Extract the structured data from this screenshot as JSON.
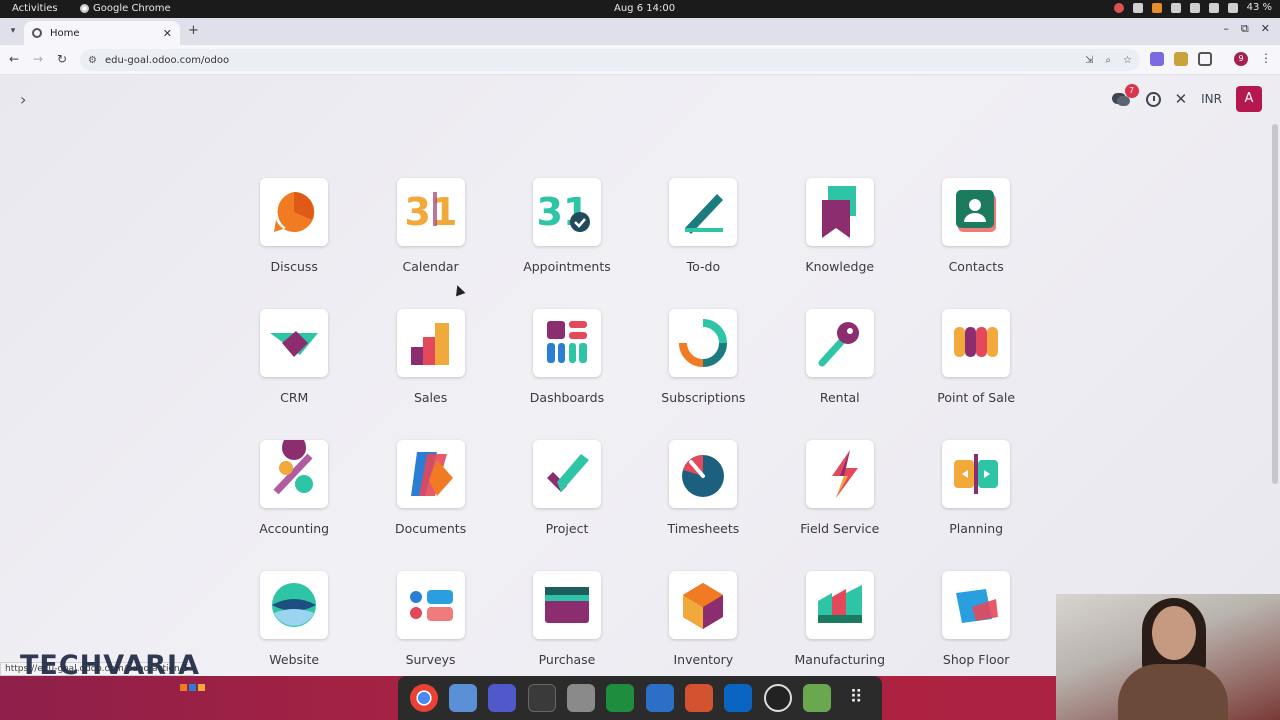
{
  "system_bar": {
    "activities": "Activities",
    "app_name": "Google Chrome",
    "clock": "Aug 6  14:00",
    "battery": "43 %"
  },
  "browser": {
    "tab_title": "Home",
    "url": "edu-goal.odoo.com/odoo",
    "status_url": "https://edu-goal.odoo.com/odoo/action-5"
  },
  "header": {
    "messages_badge": "7",
    "currency": "INR",
    "avatar_letter": "A"
  },
  "apps": [
    {
      "name": "Discuss",
      "icon": "discuss-icon"
    },
    {
      "name": "Calendar",
      "icon": "calendar-icon"
    },
    {
      "name": "Appointments",
      "icon": "appointments-icon"
    },
    {
      "name": "To-do",
      "icon": "todo-icon"
    },
    {
      "name": "Knowledge",
      "icon": "knowledge-icon"
    },
    {
      "name": "Contacts",
      "icon": "contacts-icon"
    },
    {
      "name": "CRM",
      "icon": "crm-icon"
    },
    {
      "name": "Sales",
      "icon": "sales-icon"
    },
    {
      "name": "Dashboards",
      "icon": "dashboards-icon"
    },
    {
      "name": "Subscriptions",
      "icon": "subscriptions-icon"
    },
    {
      "name": "Rental",
      "icon": "rental-icon"
    },
    {
      "name": "Point of Sale",
      "icon": "point-of-sale-icon"
    },
    {
      "name": "Accounting",
      "icon": "accounting-icon"
    },
    {
      "name": "Documents",
      "icon": "documents-icon"
    },
    {
      "name": "Project",
      "icon": "project-icon"
    },
    {
      "name": "Timesheets",
      "icon": "timesheets-icon"
    },
    {
      "name": "Field Service",
      "icon": "field-service-icon"
    },
    {
      "name": "Planning",
      "icon": "planning-icon"
    },
    {
      "name": "Website",
      "icon": "website-icon"
    },
    {
      "name": "Surveys",
      "icon": "surveys-icon"
    },
    {
      "name": "Purchase",
      "icon": "purchase-icon"
    },
    {
      "name": "Inventory",
      "icon": "inventory-icon"
    },
    {
      "name": "Manufacturing",
      "icon": "manufacturing-icon"
    },
    {
      "name": "Shop Floor",
      "icon": "shop-floor-icon"
    }
  ],
  "calendar_day": "31",
  "watermark": "TECHVARIA",
  "colors": {
    "brand_avatar": "#b5184f",
    "badge": "#d9344b"
  }
}
